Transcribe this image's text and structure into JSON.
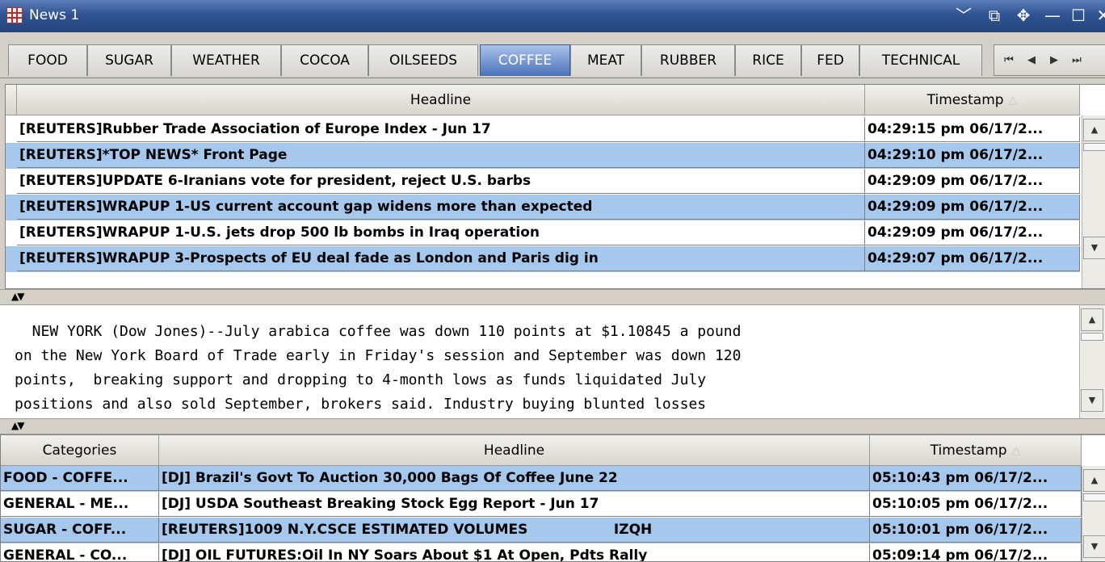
{
  "window": {
    "title": "News 1",
    "controls": [
      "﹀",
      "⧉",
      "✥",
      "—",
      "☐",
      "✕"
    ]
  },
  "tabs": [
    {
      "label": "FOOD"
    },
    {
      "label": "SUGAR"
    },
    {
      "label": "WEATHER"
    },
    {
      "label": "COCOA"
    },
    {
      "label": "OILSEEDS"
    },
    {
      "label": "COFFEE"
    },
    {
      "label": "MEAT"
    },
    {
      "label": "RUBBER"
    },
    {
      "label": "RICE"
    },
    {
      "label": "FED"
    },
    {
      "label": "TECHNICAL"
    }
  ],
  "active_tab": "COFFEE",
  "tab_nav": [
    "⏮",
    "◀",
    "▶",
    "⏭"
  ],
  "top_table": {
    "headers": {
      "headline": "Headline",
      "timestamp": "Timestamp",
      "sort_indicator": "△"
    },
    "rows": [
      {
        "headline": "[REUTERS]Rubber Trade Association of Europe Index - Jun 17",
        "timestamp": "04:29:15 pm 06/17/2..."
      },
      {
        "headline": "[REUTERS]*TOP NEWS* Front Page",
        "timestamp": "04:29:10 pm 06/17/2..."
      },
      {
        "headline": "[REUTERS]UPDATE 6-Iranians vote for president, reject U.S. barbs",
        "timestamp": "04:29:09 pm 06/17/2..."
      },
      {
        "headline": "[REUTERS]WRAPUP 1-US current account gap widens more than expected",
        "timestamp": "04:29:09 pm 06/17/2..."
      },
      {
        "headline": "[REUTERS]WRAPUP 1-U.S. jets drop 500 lb bombs in Iraq operation",
        "timestamp": "04:29:09 pm 06/17/2..."
      },
      {
        "headline": "[REUTERS]WRAPUP 3-Prospects of EU deal fade as London and Paris dig in",
        "timestamp": "04:29:07 pm 06/17/2..."
      }
    ]
  },
  "splitter_arrows": "▲▼",
  "story": {
    "lines": [
      "  NEW YORK (Dow Jones)--July arabica coffee was down 110 points at $1.10845 a pound",
      "on the New York Board of Trade early in Friday's session and September was down 120",
      "points,  breaking support and dropping to 4-month lows as funds liquidated July",
      "positions and also sold September, brokers said. Industry buying blunted losses"
    ]
  },
  "bottom_table": {
    "headers": {
      "categories": "Categories",
      "headline": "Headline",
      "timestamp": "Timestamp",
      "sort_indicator": "△"
    },
    "rows": [
      {
        "categories": "FOOD - COFFE...",
        "headline": "[DJ] Brazil's Govt To Auction 30,000 Bags Of Coffee June 22",
        "timestamp": "05:10:43 pm 06/17/2..."
      },
      {
        "categories": "GENERAL - ME...",
        "headline": "[DJ] USDA Southeast Breaking Stock Egg Report - Jun 17",
        "timestamp": "05:10:05 pm 06/17/2..."
      },
      {
        "categories": "SUGAR - COFF...",
        "headline": "[REUTERS]1009 N.Y.CSCE ESTIMATED VOLUMES                  IZQH",
        "timestamp": "05:10:01 pm 06/17/2..."
      },
      {
        "categories": "GENERAL - CO...",
        "headline": "[DJ] OIL FUTURES:Oil In NY Soars About $1 At Open, Pdts Rally",
        "timestamp": "05:09:14 pm 06/17/2..."
      }
    ]
  },
  "colors": {
    "title_bar": "#2f5394",
    "active_tab": "#4b72ba",
    "row_highlight": "#a6c8ec"
  }
}
